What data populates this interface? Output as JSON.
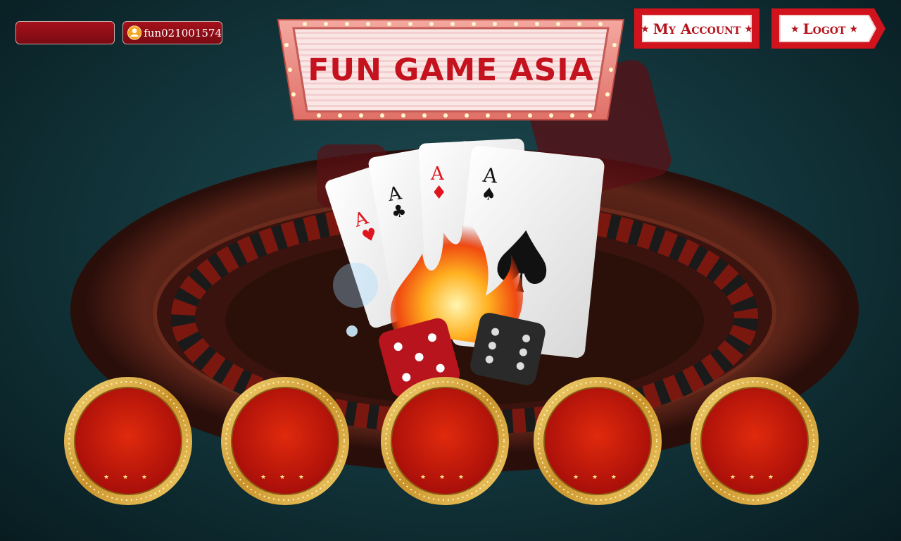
{
  "header": {
    "username": "fun021001574",
    "balance": ""
  },
  "marquee": {
    "title": "FUN GAME ASIA"
  },
  "nav": {
    "account_label": "My Account",
    "logout_label": "Logot"
  },
  "slots": [
    {
      "label": "★ ★ ★"
    },
    {
      "label": "★ ★ ★"
    },
    {
      "label": "★ ★ ★"
    },
    {
      "label": "★ ★ ★"
    },
    {
      "label": "★ ★ ★"
    }
  ],
  "colors": {
    "accent": "#c4121e",
    "gold": "#d9a93a",
    "teal": "#143a40"
  }
}
